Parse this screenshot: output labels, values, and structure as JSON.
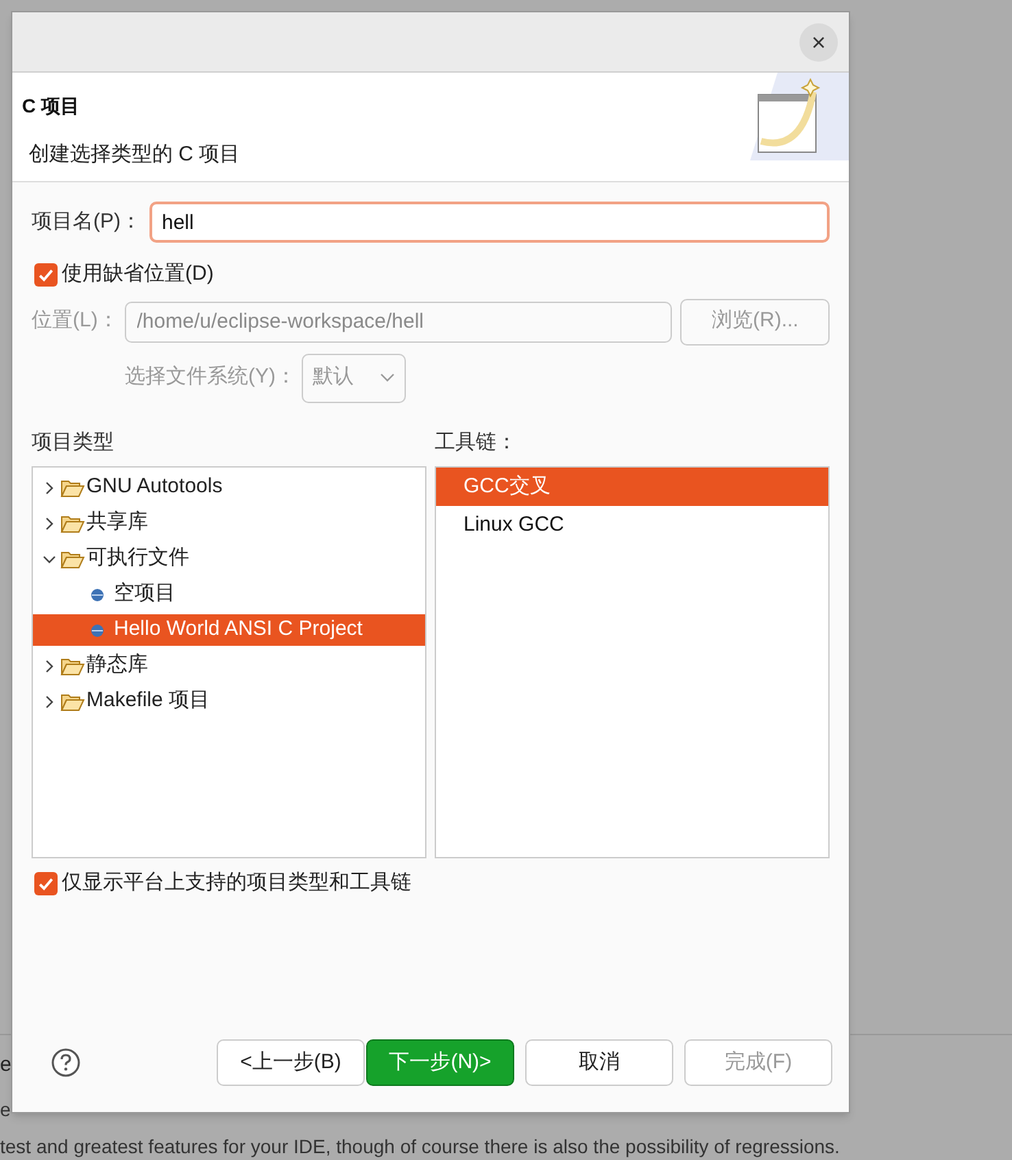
{
  "background_text": [
    "e",
    "e",
    "test and greatest features for your IDE, though of course there is also the possibility of regressions."
  ],
  "dialog": {
    "close": "×",
    "header": {
      "title": "C 项目",
      "subtitle": "创建选择类型的 C 项目"
    },
    "project_name": {
      "label": "项目名(P)：",
      "value": "hell"
    },
    "use_default_location": {
      "label": "使用缺省位置(D)",
      "checked": true
    },
    "location": {
      "label": "位置(L)：",
      "value": "/home/u/eclipse-workspace/hell",
      "disabled": true,
      "browse": "浏览(R)..."
    },
    "filesystem": {
      "label": "选择文件系统(Y)：",
      "value": "默认",
      "disabled": true
    },
    "project_types": {
      "label": "项目类型",
      "items": [
        {
          "label": "GNU Autotools",
          "kind": "folder",
          "expanded": false,
          "selected": false
        },
        {
          "label": "共享库",
          "kind": "folder",
          "expanded": false,
          "selected": false
        },
        {
          "label": "可执行文件",
          "kind": "folder",
          "expanded": true,
          "selected": false,
          "children": [
            {
              "label": "空项目",
              "kind": "item",
              "selected": false
            },
            {
              "label": "Hello World ANSI C Project",
              "kind": "item",
              "selected": true
            }
          ]
        },
        {
          "label": "静态库",
          "kind": "folder",
          "expanded": false,
          "selected": false
        },
        {
          "label": "Makefile 项目",
          "kind": "folder",
          "expanded": false,
          "selected": false
        }
      ]
    },
    "toolchains": {
      "label": "工具链：",
      "items": [
        {
          "label": "GCC交叉",
          "selected": true
        },
        {
          "label": "Linux GCC",
          "selected": false
        }
      ]
    },
    "show_supported": {
      "label": "仅显示平台上支持的项目类型和工具链",
      "checked": true
    },
    "buttons": [
      {
        "label": "<上一步(B)",
        "kind": "normal",
        "disabled": false
      },
      {
        "label": "下一步(N)>",
        "kind": "primary",
        "disabled": false
      },
      {
        "label": "取消",
        "kind": "normal",
        "disabled": false
      },
      {
        "label": "完成(F)",
        "kind": "normal",
        "disabled": true
      }
    ]
  }
}
